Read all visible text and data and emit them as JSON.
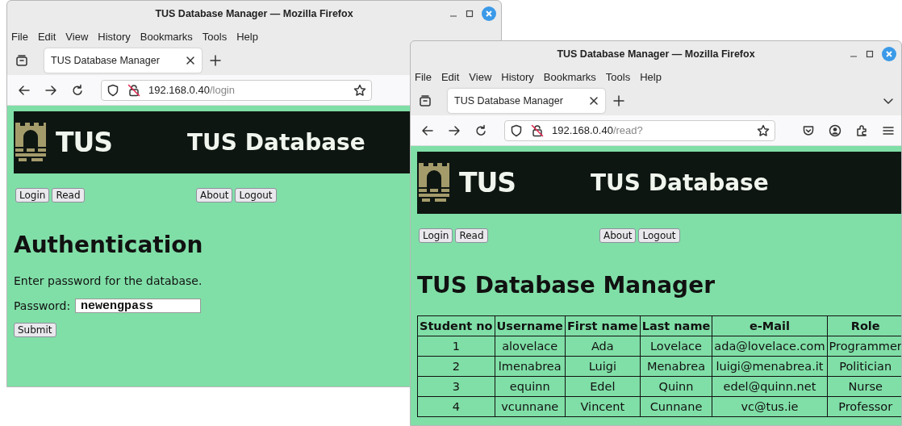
{
  "windows": [
    {
      "title": "TUS Database Manager — Mozilla Firefox",
      "menu": [
        "File",
        "Edit",
        "View",
        "History",
        "Bookmarks",
        "Tools",
        "Help"
      ],
      "tab": "TUS Database Manager",
      "url": {
        "host": "192.168.0.40",
        "path": "/login"
      },
      "page": {
        "kind": "login",
        "logo": "TUS",
        "banner": "TUS Database",
        "nav_left": [
          "Login",
          "Read"
        ],
        "nav_right": [
          "About",
          "Logout"
        ],
        "heading": "Authentication",
        "text": "Enter password for the database.",
        "field": {
          "label": "Password:",
          "value": "newengpass"
        },
        "submit": "Submit"
      }
    },
    {
      "title": "TUS Database Manager — Mozilla Firefox",
      "menu": [
        "File",
        "Edit",
        "View",
        "History",
        "Bookmarks",
        "Tools",
        "Help"
      ],
      "tab": "TUS Database Manager",
      "url": {
        "host": "192.168.0.40",
        "path": "/read?"
      },
      "page": {
        "kind": "table",
        "logo": "TUS",
        "banner": "TUS Database",
        "nav_left": [
          "Login",
          "Read"
        ],
        "nav_right": [
          "About",
          "Logout"
        ],
        "heading": "TUS Database Manager",
        "table": {
          "columns": [
            "Student no",
            "Username",
            "First name",
            "Last name",
            "e-Mail",
            "Role"
          ],
          "rows": [
            [
              "1",
              "alovelace",
              "Ada",
              "Lovelace",
              "ada@lovelace.com",
              "Programmer"
            ],
            [
              "2",
              "lmenabrea",
              "Luigi",
              "Menabrea",
              "luigi@menabrea.it",
              "Politician"
            ],
            [
              "3",
              "equinn",
              "Edel",
              "Quinn",
              "edel@quinn.net",
              "Nurse"
            ],
            [
              "4",
              "vcunnane",
              "Vincent",
              "Cunnane",
              "vc@tus.ie",
              "Professor"
            ]
          ]
        }
      }
    }
  ]
}
